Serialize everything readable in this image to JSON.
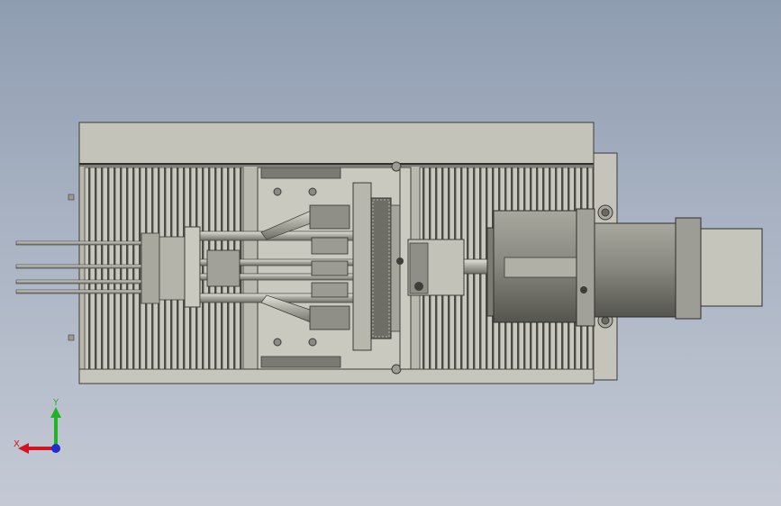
{
  "viewport": {
    "background_top": "#8f9db1",
    "background_bottom": "#c4c9d4",
    "model_fill": "#bdbdb3",
    "model_dark": "#5c5c56",
    "motor_fill": "#6b6b63"
  },
  "triad": {
    "x_label": "X",
    "y_label": "Y",
    "x_color": "#d2141e",
    "y_color": "#1fb426",
    "z_color": "#1e2cd0"
  }
}
